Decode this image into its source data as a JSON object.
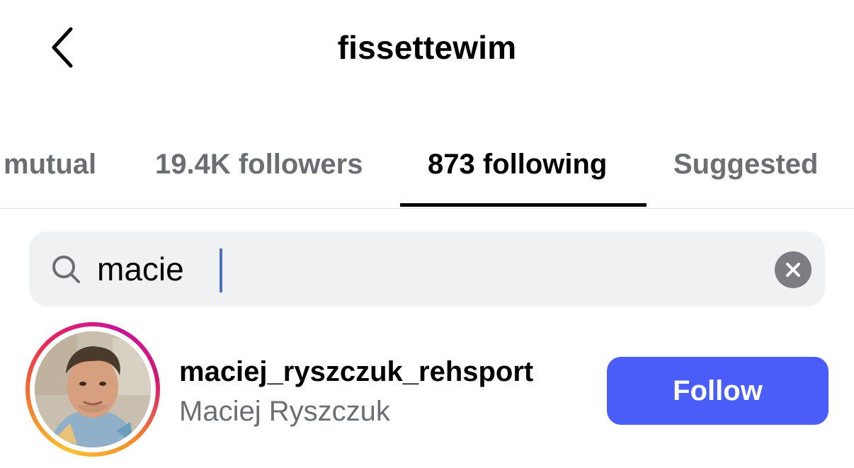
{
  "header": {
    "title": "fissettewim",
    "back_icon": "chevron-left-icon"
  },
  "tabs": [
    {
      "label": "mutual",
      "active": false
    },
    {
      "label": "19.4K followers",
      "active": false
    },
    {
      "label": "873 following",
      "active": true
    },
    {
      "label": "Suggested",
      "active": false
    }
  ],
  "search": {
    "value": "macie",
    "icon": "search-icon",
    "clear_icon": "clear-icon"
  },
  "results": [
    {
      "username": "maciej_ryszczuk_rehsport",
      "full_name": "Maciej Ryszczuk",
      "action_label": "Follow",
      "has_story_ring": true
    }
  ],
  "colors": {
    "follow_button": "#4a5df9",
    "search_bg": "#eff1f3",
    "inactive_tab": "#6b6f73",
    "caret": "#4e6fbe"
  }
}
